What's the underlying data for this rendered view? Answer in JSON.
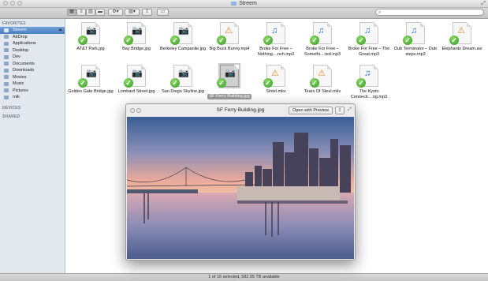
{
  "window": {
    "title": "Streem"
  },
  "search": {
    "placeholder": ""
  },
  "sidebar": {
    "favorites_header": "FAVORITES",
    "favorites": [
      {
        "label": "Streem",
        "icon": "folder-icon",
        "selected": true
      },
      {
        "label": "AirDrop",
        "icon": "airdrop-icon"
      },
      {
        "label": "Applications",
        "icon": "applications-icon"
      },
      {
        "label": "Desktop",
        "icon": "desktop-icon"
      },
      {
        "label": "Dev",
        "icon": "folder-icon"
      },
      {
        "label": "Documents",
        "icon": "documents-icon"
      },
      {
        "label": "Downloads",
        "icon": "downloads-icon"
      },
      {
        "label": "Movies",
        "icon": "movies-icon"
      },
      {
        "label": "Music",
        "icon": "music-icon"
      },
      {
        "label": "Pictures",
        "icon": "pictures-icon"
      },
      {
        "label": "rnik",
        "icon": "home-icon"
      }
    ],
    "devices_header": "DEVICES",
    "shared_header": "SHARED"
  },
  "files": [
    {
      "label": "AT&T Park.jpg",
      "type": "image"
    },
    {
      "label": "Bay Bridge.jpg",
      "type": "image"
    },
    {
      "label": "Berkeley Campanile.jpg",
      "type": "image"
    },
    {
      "label": "Big Buck Bunny.mp4",
      "type": "video"
    },
    {
      "label": "Broke For Free – Nothing....nch.mp3",
      "type": "audio"
    },
    {
      "label": "Broke For Free – Somethi....ted.mp3",
      "type": "audio"
    },
    {
      "label": "Broke For Free – The Great.mp3",
      "type": "audio"
    },
    {
      "label": "Dub Terminator – Dub steps.mp3",
      "type": "audio"
    },
    {
      "label": "Elephants Dream.avi",
      "type": "video"
    },
    {
      "label": "Golden Gate Bridge.jpg",
      "type": "image"
    },
    {
      "label": "Lombard Street.jpg",
      "type": "image"
    },
    {
      "label": "San Diego Skyline.jpg",
      "type": "image"
    },
    {
      "label": "SF Ferry Building.jpg",
      "type": "image",
      "selected": true
    },
    {
      "label": "Sintel.mkv",
      "type": "video"
    },
    {
      "label": "Tears Of Steel.mkv",
      "type": "video"
    },
    {
      "label": "The Kyoto Connecti....og.mp3",
      "type": "audio"
    }
  ],
  "quicklook": {
    "title": "SF Ferry Building.jpg",
    "open_button": "Open with Preview"
  },
  "status": {
    "text": "1 of 16 selected, 582.95 TB available"
  },
  "colors": {
    "sidebar_bg": "#e3e8ee",
    "selection": "#4a7fc1",
    "sync_badge": "#2f9a1e"
  }
}
